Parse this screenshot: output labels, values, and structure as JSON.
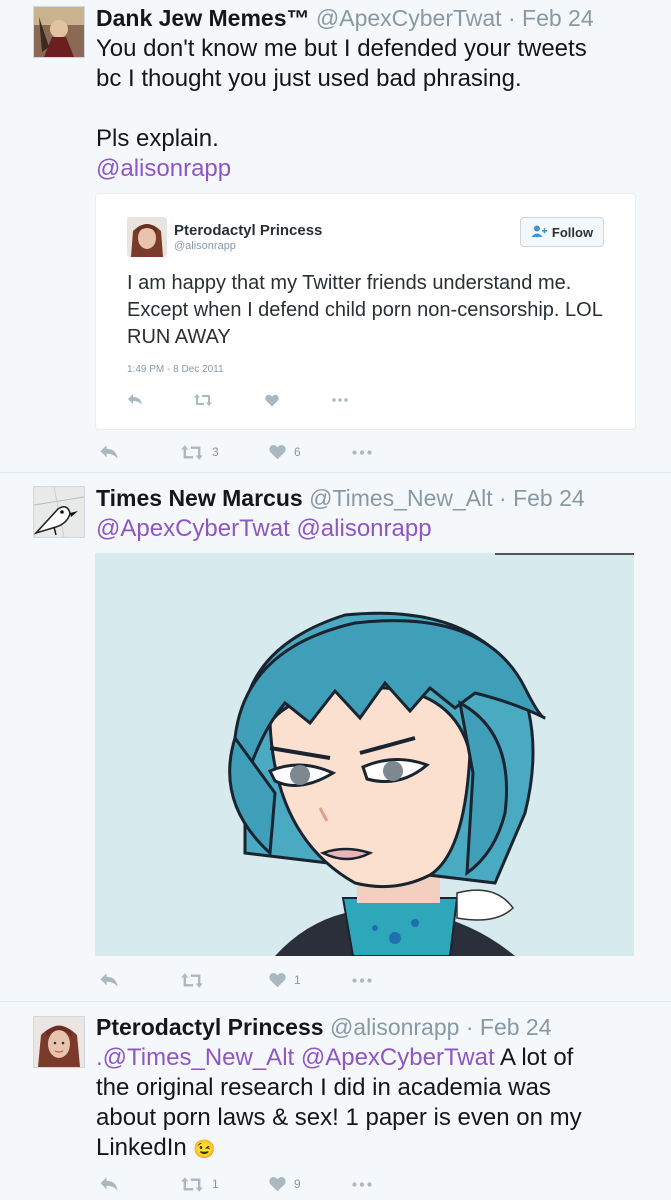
{
  "tweets": [
    {
      "name": "Dank Jew Memes™",
      "handle": "@ApexCyberTwat",
      "dot": "·",
      "date": "Feb 24",
      "text_lines": [
        "You don't know me but I defended your tweets",
        "bc I thought you just used bad phrasing."
      ],
      "text_2": "Pls explain.",
      "mention": "@alisonrapp",
      "retweets": "3",
      "likes": "6",
      "quoted": {
        "name": "Pterodactyl Princess",
        "handle": "@alisonrapp",
        "follow_label": "Follow",
        "text": "I am happy that my Twitter friends understand me. Except when I defend child porn non-censorship. LOL RUN AWAY",
        "timestamp": "1:49 PM - 8 Dec 2011"
      }
    },
    {
      "name": "Times New Marcus",
      "handle": "@Times_New_Alt",
      "dot": "·",
      "date": "Feb 24",
      "mentions": "@ApexCyberTwat @alisonrapp",
      "retweets": "",
      "likes": "1"
    },
    {
      "name": "Pterodactyl Princess",
      "handle": "@alisonrapp",
      "dot": "·",
      "date": "Feb 24",
      "mentions": ".@Times_New_Alt @ApexCyberTwat",
      "text_a": " A lot of",
      "text_lines": [
        "the original research I did in academia was",
        "about porn laws & sex! 1 paper is even on my"
      ],
      "text_last": "LinkedIn",
      "emoji": "😉",
      "retweets": "1",
      "likes": "9"
    }
  ],
  "colors": {
    "link": "#8f55c6",
    "muted": "#8899a6",
    "icon": "#aab8c2",
    "background": "#f5f8fa"
  },
  "icons": [
    "reply-icon",
    "retweet-icon",
    "heart-icon",
    "more-icon",
    "follow-person-icon"
  ]
}
